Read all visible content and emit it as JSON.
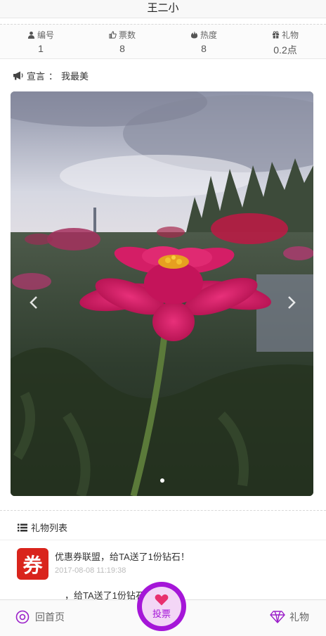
{
  "header": {
    "title": "王二小"
  },
  "stats": [
    {
      "icon": "user-icon",
      "label": "编号",
      "value": "1"
    },
    {
      "icon": "thumbs-up-icon",
      "label": "票数",
      "value": "8"
    },
    {
      "icon": "fire-icon",
      "label": "热度",
      "value": "8"
    },
    {
      "icon": "gift-icon",
      "label": "礼物",
      "value": "0.2点"
    }
  ],
  "declaration": {
    "label": "宣言",
    "separator": "：",
    "text": "我最美"
  },
  "carousel": {
    "active_index": 0,
    "dot_count": 1
  },
  "gift_list": {
    "title": "礼物列表",
    "items": [
      {
        "avatar_text": "券",
        "text": "优惠券联盟，给TA送了1份钻石！",
        "time": "2017-08-08 11:19:38"
      },
      {
        "avatar_text": "",
        "text": "，给TA送了1份钻石！",
        "time": ""
      }
    ]
  },
  "bottom_nav": {
    "home_label": "回首页",
    "vote_label": "投票",
    "gift_label": "礼物"
  },
  "colors": {
    "accent": "#a516d8",
    "avatar_red": "#d9241c"
  }
}
